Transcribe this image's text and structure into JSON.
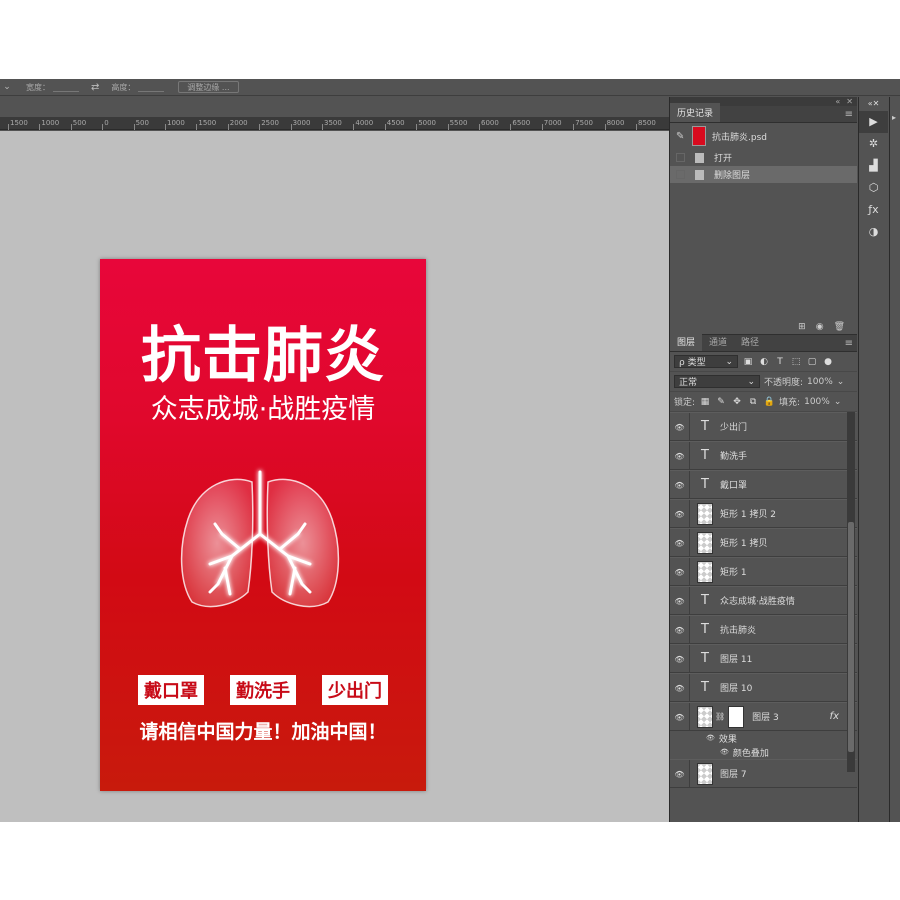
{
  "options_bar": {
    "width_label": "宽度：",
    "height_label": "高度：",
    "swap_icon": "swap-arrows-icon",
    "refine_button": "调整边缘 ..."
  },
  "ruler": {
    "ticks": [
      "1500",
      "1000",
      "500",
      "0",
      "500",
      "1000",
      "1500",
      "2000",
      "2500",
      "3000",
      "3500",
      "4000",
      "4500",
      "5000",
      "5500",
      "6000",
      "6500",
      "7000",
      "7500",
      "8000",
      "8500"
    ]
  },
  "poster": {
    "title": "抗击肺炎",
    "subtitle": "众志成城·战胜疫情",
    "tags": [
      "戴口罩",
      "勤洗手",
      "少出门"
    ],
    "slogan": "请相信中国力量！加油中国！",
    "colors": {
      "bg_top": "#e8063a",
      "bg_bottom": "#c81a0c",
      "tag_text": "#c80b18"
    }
  },
  "history_panel": {
    "tab": "历史记录",
    "source_file": "抗击肺炎.psd",
    "items": [
      {
        "label": "打开",
        "selected": false
      },
      {
        "label": "删除图层",
        "selected": true
      }
    ]
  },
  "layers_panel": {
    "tabs": [
      "图层",
      "通道",
      "路径"
    ],
    "filter_label": "ρ 类型",
    "blend_mode": "正常",
    "opacity_label": "不透明度:",
    "opacity_value": "100%",
    "lock_label": "锁定:",
    "fill_label": "填充:",
    "fill_value": "100%",
    "layers": [
      {
        "type": "text",
        "name": "少出门"
      },
      {
        "type": "text",
        "name": "勤洗手"
      },
      {
        "type": "text",
        "name": "戴口罩"
      },
      {
        "type": "shape",
        "name": "矩形 1 拷贝 2"
      },
      {
        "type": "shape",
        "name": "矩形 1 拷贝"
      },
      {
        "type": "shape",
        "name": "矩形 1"
      },
      {
        "type": "text",
        "name": "众志成城·战胜疫情"
      },
      {
        "type": "text",
        "name": "抗击肺炎"
      },
      {
        "type": "text",
        "name": "图层 11"
      },
      {
        "type": "text",
        "name": "图层 10"
      }
    ],
    "masked_layer": {
      "name": "图层 3",
      "fx": "fx"
    },
    "effects_label": "效果",
    "effect_item": "颜色叠加",
    "bottom_layer": "图层 7"
  }
}
